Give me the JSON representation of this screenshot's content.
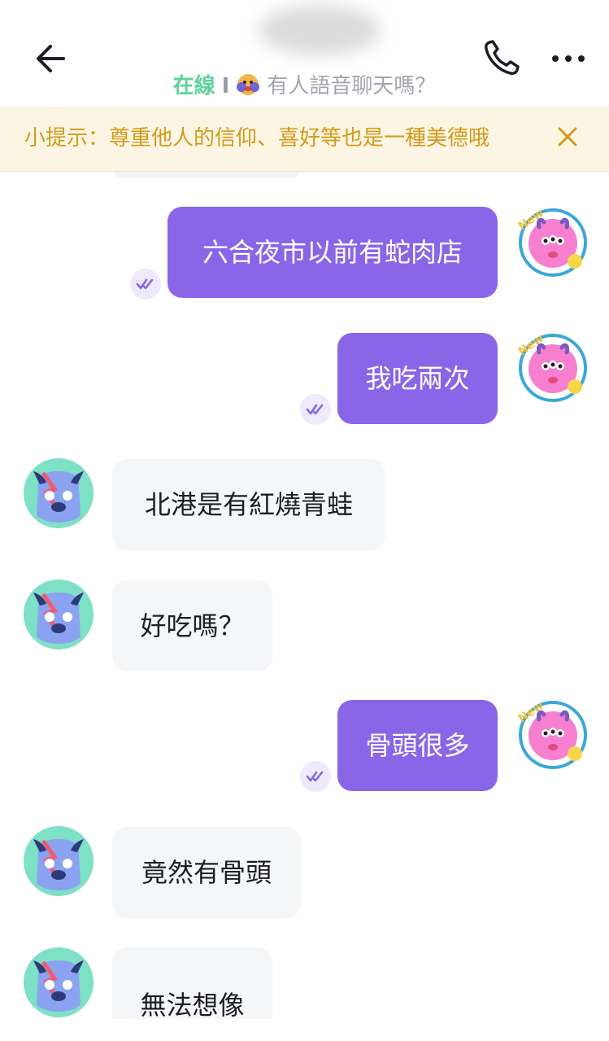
{
  "header": {
    "status_online": "在線",
    "status_separator": "I",
    "status_message": "有人語音聊天嗎？",
    "back_icon": "arrow-left-icon",
    "call_icon": "phone-icon",
    "more_icon": "more-dots-icon"
  },
  "tip": {
    "text": "小提示：尊重他人的信仰、喜好等也是一種美德哦",
    "close_icon": "close-icon"
  },
  "colors": {
    "my_bubble": "#8966e8",
    "their_bubble": "#f5f6f8",
    "online": "#5fd39a",
    "tip_text": "#d39b1a",
    "tip_bg": "#fdf5e3"
  },
  "messages": [
    {
      "sender": "me",
      "text": "六合夜市以前有蛇肉店",
      "read": true
    },
    {
      "sender": "me",
      "text": "我吃兩次",
      "read": true
    },
    {
      "sender": "them",
      "text": "北港是有紅燒青蛙"
    },
    {
      "sender": "them",
      "text": "好吃嗎？"
    },
    {
      "sender": "me",
      "text": "骨頭很多",
      "read": true
    },
    {
      "sender": "them",
      "text": "竟然有骨頭"
    },
    {
      "sender": "them",
      "text": "無法想像"
    }
  ],
  "avatars": {
    "me_badge": "New"
  }
}
